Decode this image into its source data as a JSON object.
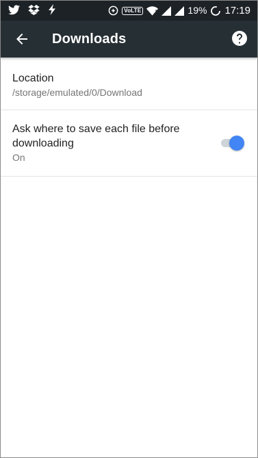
{
  "status_bar": {
    "left_icons": [
      "twitter-icon",
      "dropbox-icon",
      "flash-icon"
    ],
    "volte": "VoLTE",
    "battery": "19%",
    "time": "17:19"
  },
  "toolbar": {
    "title": "Downloads",
    "back_icon": "arrow-left-icon",
    "help_icon": "help-circle-icon",
    "background": "#262f34"
  },
  "settings": {
    "location": {
      "title": "Location",
      "summary": "/storage/emulated/0/Download"
    },
    "ask_before_download": {
      "title": "Ask where to save each file before downloading",
      "summary": "On",
      "toggle_on": true,
      "accent": "#4285f4"
    }
  }
}
